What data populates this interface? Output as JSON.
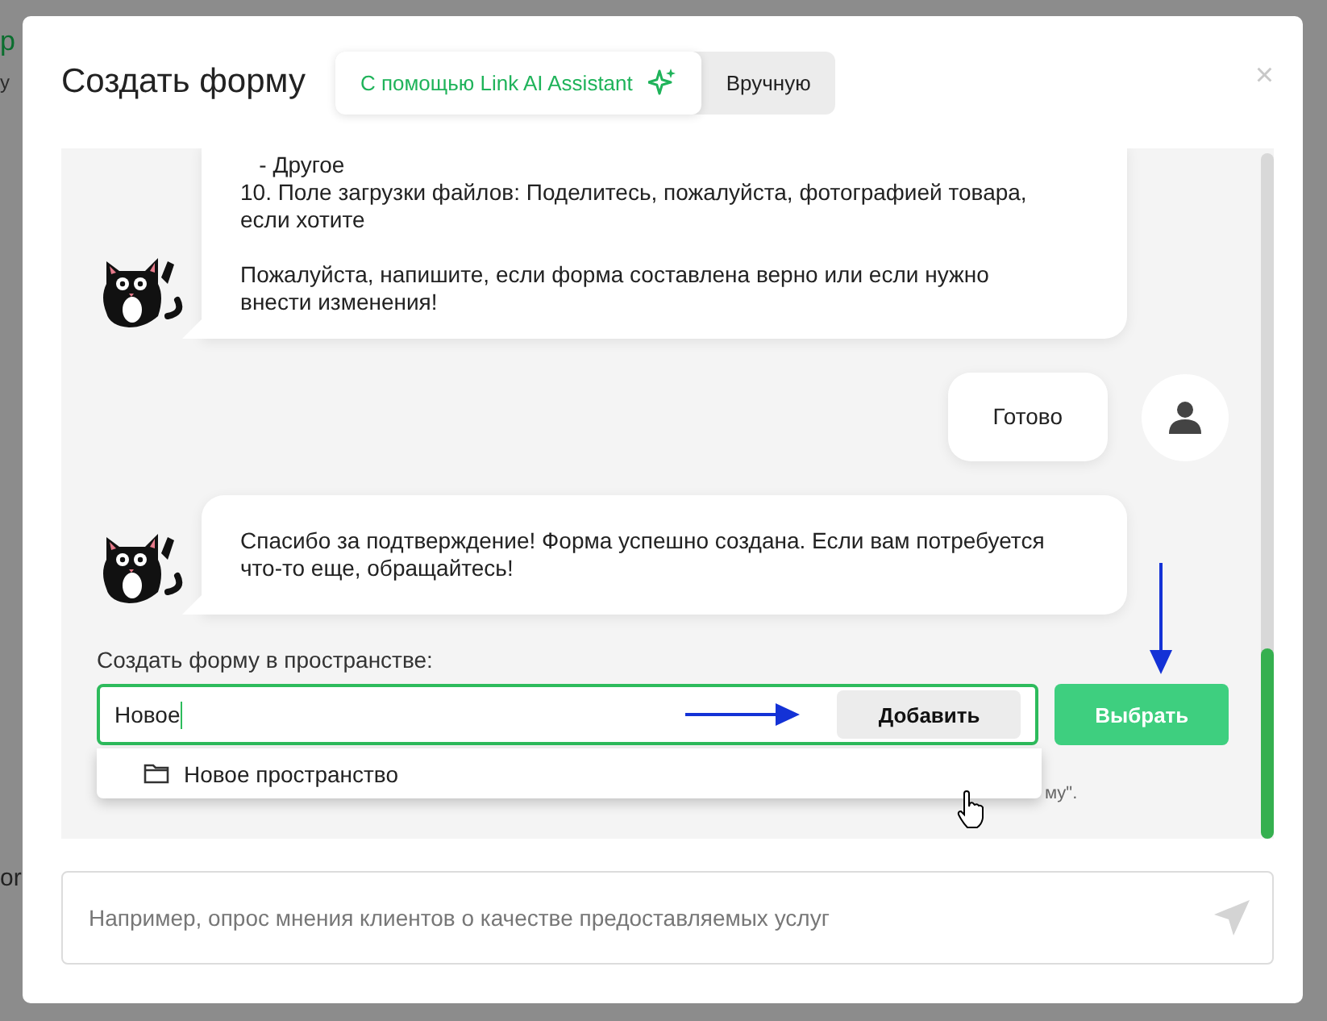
{
  "background_fragments": [
    "р",
    "у",
    "or"
  ],
  "modal": {
    "title": "Создать форму",
    "close": "×",
    "mode_tabs": [
      {
        "label": "С помощью Link AI Assistant",
        "selected": true
      },
      {
        "label": "Вручную",
        "selected": false
      }
    ]
  },
  "messages": [
    {
      "kind": "bot",
      "paragraphs": [
        "   - Другое",
        "10. Поле загрузки файлов: Поделитесь, пожалуйста, фотографией товара, если хотите",
        "Пожалуйста, напишите, если форма составлена верно или если нужно внести изменения!"
      ]
    },
    {
      "kind": "user",
      "paragraphs": [
        "Готово"
      ]
    },
    {
      "kind": "bot",
      "paragraphs": [
        "Спасибо за подтверждение! Форма успешно создана. Если вам потребуется что-то еще, обращайтесь!"
      ]
    }
  ],
  "space_picker": {
    "label": "Создать форму в пространстве:",
    "value": "Новое",
    "add_button": "Добавить",
    "select_button": "Выбрать",
    "hint": "му\".",
    "suggestions": [
      {
        "label": "Новое пространство"
      }
    ]
  },
  "composer": {
    "placeholder": "Например, опрос мнения клиентов о качестве предоставляемых услуг"
  }
}
